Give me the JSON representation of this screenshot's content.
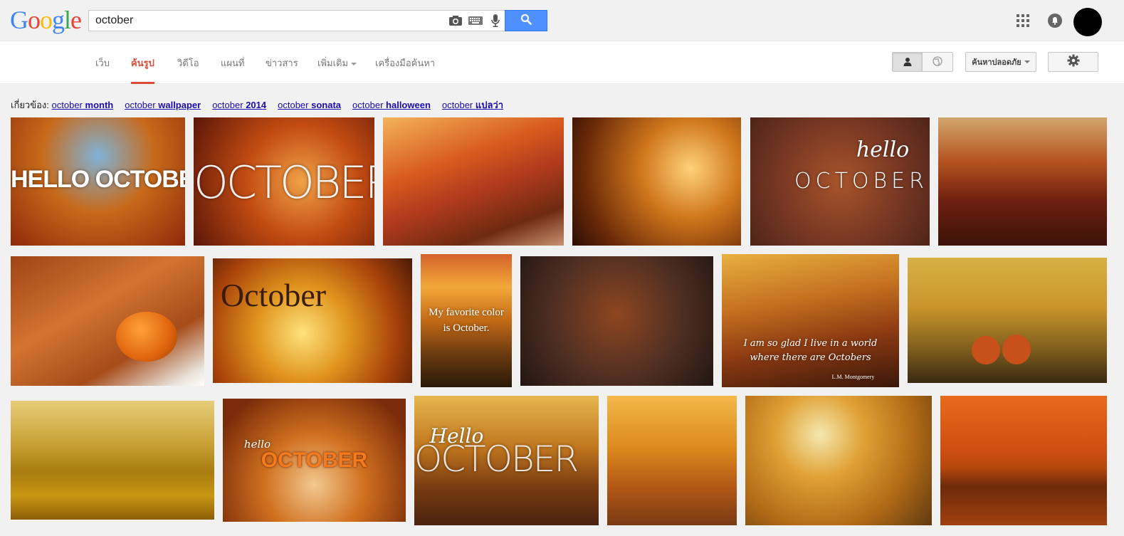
{
  "header": {
    "logo_letters": [
      {
        "ch": "G",
        "color": "#4285f4"
      },
      {
        "ch": "o",
        "color": "#ea4335"
      },
      {
        "ch": "o",
        "color": "#fbbc05"
      },
      {
        "ch": "g",
        "color": "#4285f4"
      },
      {
        "ch": "l",
        "color": "#34a853"
      },
      {
        "ch": "e",
        "color": "#ea4335"
      }
    ],
    "search_query": "october",
    "icons": [
      "camera-icon",
      "keyboard-icon",
      "microphone-icon",
      "search-icon",
      "apps-grid-icon",
      "notifications-icon"
    ]
  },
  "nav": {
    "tabs": [
      {
        "label": "เว็บ",
        "active": false
      },
      {
        "label": "ค้นรูป",
        "active": true
      },
      {
        "label": "วิดีโอ",
        "active": false
      },
      {
        "label": "แผนที่",
        "active": false
      },
      {
        "label": "ข่าวสาร",
        "active": false
      },
      {
        "label": "เพิ่มเติม",
        "active": false,
        "dropdown": true
      },
      {
        "label": "เครื่องมือค้นหา",
        "active": false
      }
    ],
    "safe_search_label": "ค้นหาปลอดภัย",
    "accent": "#dd4b39"
  },
  "related": {
    "prefix": "เกี่ยวข้อง:",
    "items": [
      {
        "base": "october",
        "extra": "month"
      },
      {
        "base": "october",
        "extra": "wallpaper"
      },
      {
        "base": "october",
        "extra": "2014"
      },
      {
        "base": "october",
        "extra": "sonata"
      },
      {
        "base": "october",
        "extra": "halloween"
      },
      {
        "base": "october",
        "extra": "แปลว่า"
      }
    ]
  },
  "images": {
    "captions": {
      "hello_october": "HELLO OCTOBER",
      "october_big": "OCTOBER",
      "hello_script": "hello",
      "october_spaced": "OCTOBER",
      "october_serif": "October",
      "favorite_color_1": "My favorite color",
      "favorite_color_2": "is October.",
      "quote_1": "I am so glad I live in a world",
      "quote_2": "where there are Octobers",
      "quote_author": "L.M. Montgomery",
      "hello_small": "hello",
      "october_orange": "OCTOBER",
      "hello_cap": "Hello",
      "october_outline": "OCTOBER"
    }
  }
}
